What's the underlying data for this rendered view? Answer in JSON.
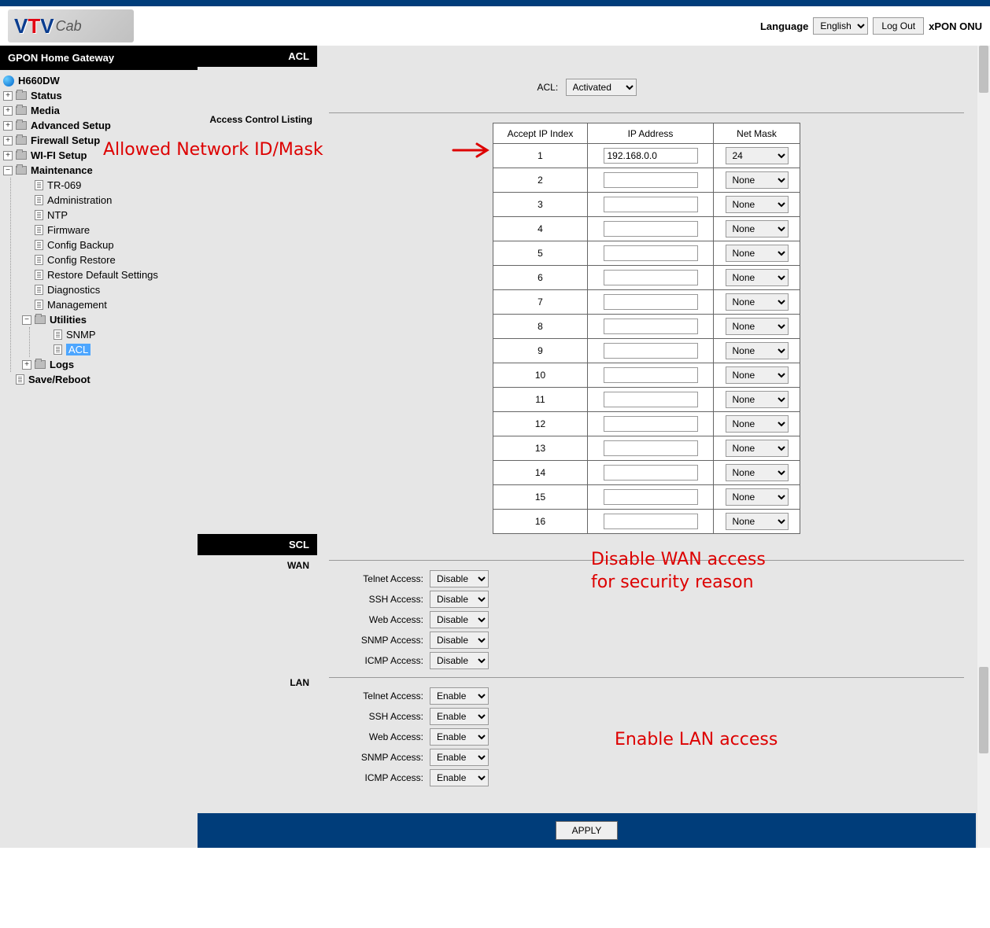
{
  "header": {
    "language_label": "Language",
    "language_value": "English",
    "logout_label": "Log Out",
    "product_label": "xPON ONU",
    "logo_text1": "V",
    "logo_text2": "T",
    "logo_text3": "V",
    "logo_text4": "Cab"
  },
  "sidebar": {
    "title": "GPON Home Gateway",
    "device": "H660DW",
    "items": {
      "status": "Status",
      "media": "Media",
      "advanced": "Advanced Setup",
      "firewall": "Firewall Setup",
      "wifi": "WI-FI Setup",
      "maintenance": "Maintenance",
      "tr069": "TR-069",
      "administration": "Administration",
      "ntp": "NTP",
      "firmware": "Firmware",
      "config_backup": "Config Backup",
      "config_restore": "Config Restore",
      "restore_default": "Restore Default Settings",
      "diagnostics": "Diagnostics",
      "management": "Management",
      "utilities": "Utilities",
      "snmp": "SNMP",
      "acl": "ACL",
      "logs": "Logs",
      "save_reboot": "Save/Reboot"
    }
  },
  "acl": {
    "section_acl": "ACL",
    "section_listing": "Access Control Listing",
    "acl_label": "ACL:",
    "acl_value": "Activated",
    "col_index": "Accept IP Index",
    "col_ip": "IP Address",
    "col_mask": "Net Mask",
    "rows": [
      {
        "idx": "1",
        "ip": "192.168.0.0",
        "mask": "24"
      },
      {
        "idx": "2",
        "ip": "",
        "mask": "None"
      },
      {
        "idx": "3",
        "ip": "",
        "mask": "None"
      },
      {
        "idx": "4",
        "ip": "",
        "mask": "None"
      },
      {
        "idx": "5",
        "ip": "",
        "mask": "None"
      },
      {
        "idx": "6",
        "ip": "",
        "mask": "None"
      },
      {
        "idx": "7",
        "ip": "",
        "mask": "None"
      },
      {
        "idx": "8",
        "ip": "",
        "mask": "None"
      },
      {
        "idx": "9",
        "ip": "",
        "mask": "None"
      },
      {
        "idx": "10",
        "ip": "",
        "mask": "None"
      },
      {
        "idx": "11",
        "ip": "",
        "mask": "None"
      },
      {
        "idx": "12",
        "ip": "",
        "mask": "None"
      },
      {
        "idx": "13",
        "ip": "",
        "mask": "None"
      },
      {
        "idx": "14",
        "ip": "",
        "mask": "None"
      },
      {
        "idx": "15",
        "ip": "",
        "mask": "None"
      },
      {
        "idx": "16",
        "ip": "",
        "mask": "None"
      }
    ]
  },
  "scl": {
    "section_scl": "SCL",
    "wan_label": "WAN",
    "lan_label": "LAN",
    "telnet": "Telnet Access:",
    "ssh": "SSH Access:",
    "web": "Web Access:",
    "snmp": "SNMP Access:",
    "icmp": "ICMP Access:",
    "disable": "Disable",
    "enable": "Enable"
  },
  "apply_label": "APPLY",
  "annotations": {
    "a1": "Allowed Network ID/Mask",
    "a2_l1": "Disable WAN access",
    "a2_l2": "for security reason",
    "a3": "Enable LAN access"
  }
}
